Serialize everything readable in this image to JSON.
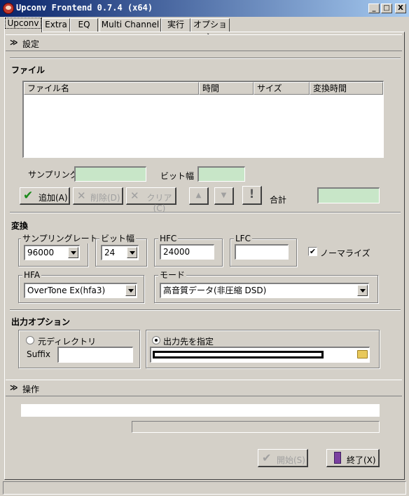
{
  "window": {
    "title": "Upconv Frontend 0.7.4 (x64)",
    "min": "_",
    "max": "□",
    "close": "X"
  },
  "tabs": [
    "Upconv",
    "Extra",
    "EQ",
    "Multi Channel",
    "実行",
    "オプション"
  ],
  "settings_section": {
    "label": "設定"
  },
  "file": {
    "heading": "ファイル",
    "columns": [
      "ファイル名",
      "時間",
      "サイズ",
      "変換時間"
    ],
    "sampling_label": "サンプリング",
    "bit_label": "ビット幅",
    "add_button": "追加(A)",
    "delete_button": "削除(D)",
    "clear_button": "クリア(C)",
    "up_button": "▲",
    "down_button": "▼",
    "warn_button": "!",
    "total_label": "合計"
  },
  "convert": {
    "heading": "変換",
    "sampling_rate_label": "サンプリングレート",
    "sampling_rate_value": "96000",
    "bit_label": "ビット幅",
    "bit_value": "24",
    "hfc_label": "HFC",
    "hfc_value": "24000",
    "lfc_label": "LFC",
    "lfc_value": "",
    "normalize_label": "ノーマライズ",
    "normalize_checked": true,
    "hfa_label": "HFA",
    "hfa_value": "OverTone Ex(hfa3)",
    "mode_label": "モード",
    "mode_value": "高音質データ(非圧縮 DSD)"
  },
  "output": {
    "heading": "出力オプション",
    "source_dir_label": "元ディレクトリ",
    "suffix_label": "Suffix",
    "suffix_value": "",
    "dest_label": "出力先を指定"
  },
  "operation_section": {
    "label": "操作"
  },
  "actions": {
    "start_button": "開始(S)",
    "exit_button": "終了(X)"
  },
  "colors": {
    "title_start": "#0a246a",
    "title_end": "#a6caf0",
    "field_green": "#c8e6c8",
    "face": "#d4d0c8"
  }
}
